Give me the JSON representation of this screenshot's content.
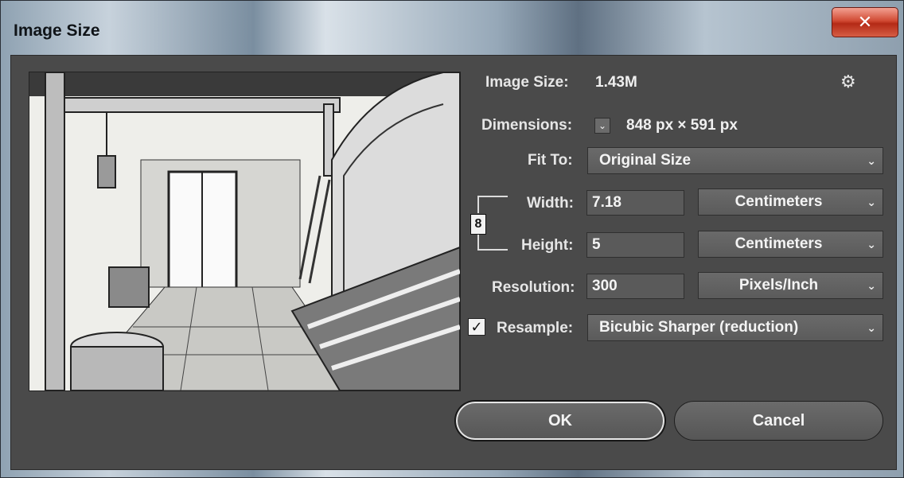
{
  "window": {
    "title": "Image Size",
    "close_glyph": "✕"
  },
  "info": {
    "image_size_label": "Image Size:",
    "image_size_value": "1.43M",
    "dimensions_label": "Dimensions:",
    "dimensions_value": "848 px  ×  591 px",
    "dimensions_toggle": "⌄"
  },
  "fit_to": {
    "label": "Fit To:",
    "value": "Original Size"
  },
  "width": {
    "label": "Width:",
    "value": "7.18",
    "unit": "Centimeters"
  },
  "height": {
    "label": "Height:",
    "value": "5",
    "unit": "Centimeters"
  },
  "resolution": {
    "label": "Resolution:",
    "value": "300",
    "unit": "Pixels/Inch"
  },
  "resample": {
    "checked": true,
    "check_glyph": "✓",
    "label": "Resample:",
    "value": "Bicubic Sharper (reduction)"
  },
  "buttons": {
    "ok": "OK",
    "cancel": "Cancel"
  },
  "icons": {
    "gear": "gear-icon",
    "chain": "link-icon",
    "chevron": "chevron-down-icon"
  },
  "colors": {
    "dialog_bg": "#4a4a4a",
    "close_red": "#c8432b"
  }
}
